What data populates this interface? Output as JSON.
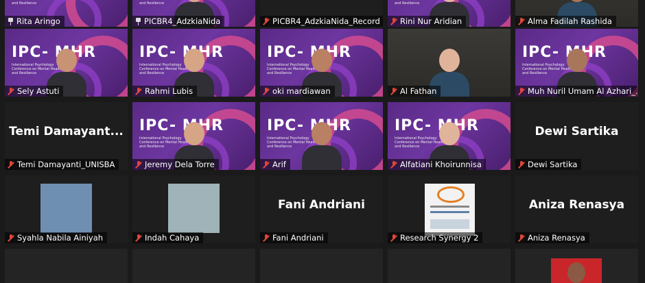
{
  "participants": [
    {
      "name": "Rita Aringo",
      "icon": "pin-icon",
      "bg": "banner"
    },
    {
      "name": "PICBR4_AdzkiaNida",
      "icon": "pin-icon",
      "bg": "banner"
    },
    {
      "name": "PICBR4_AdzkiaNida_Record",
      "icon": "mic-muted-icon",
      "bg": "dark"
    },
    {
      "name": "Rini Nur Aridian",
      "icon": "mic-muted-icon",
      "bg": "banner"
    },
    {
      "name": "Alma Fadilah Rashida",
      "icon": "mic-muted-icon",
      "bg": "room"
    },
    {
      "name": "Sely Astuti",
      "icon": "mic-muted-icon",
      "bg": "banner"
    },
    {
      "name": "Rahmi Lubis",
      "icon": "mic-muted-icon",
      "bg": "banner"
    },
    {
      "name": "oki mardiawan",
      "icon": "mic-muted-icon",
      "bg": "banner"
    },
    {
      "name": "Al Fathan",
      "icon": "mic-muted-icon",
      "bg": "room"
    },
    {
      "name": "Muh Nuril Umam Al Azhari_...",
      "icon": "mic-muted-icon",
      "bg": "banner"
    },
    {
      "name": "Temi Damayanti_UNISBA",
      "icon": "mic-muted-icon",
      "bg": "name",
      "center": "Temi  Damayant..."
    },
    {
      "name": "Jeremy Dela Torre",
      "icon": "mic-muted-icon",
      "bg": "banner"
    },
    {
      "name": "Arif",
      "icon": "mic-muted-icon",
      "bg": "banner"
    },
    {
      "name": "Alfatiani Khoirunnisa",
      "icon": "mic-muted-icon",
      "bg": "banner"
    },
    {
      "name": "Dewi Sartika",
      "icon": "mic-muted-icon",
      "bg": "name",
      "center": "Dewi Sartika"
    },
    {
      "name": "Syahla Nabila Ainiyah",
      "icon": "mic-muted-icon",
      "bg": "photo"
    },
    {
      "name": "Indah Cahaya",
      "icon": "mic-muted-icon",
      "bg": "photo"
    },
    {
      "name": "Fani Andriani",
      "icon": "mic-muted-icon",
      "bg": "name",
      "center": "Fani Andriani"
    },
    {
      "name": "Research Synergy 2",
      "icon": "mic-muted-icon",
      "bg": "logo"
    },
    {
      "name": "Aniza Renasya",
      "icon": "mic-muted-icon",
      "bg": "name",
      "center": "Aniza Renasya"
    }
  ],
  "banner": {
    "title": "IPC- MHR",
    "subtitle": "International Psychology Conference on Mental Health and Resilience"
  },
  "colors": {
    "muted": "#e0463a",
    "active_speaker": "#8fd14f",
    "tile_bg": "#242424"
  }
}
